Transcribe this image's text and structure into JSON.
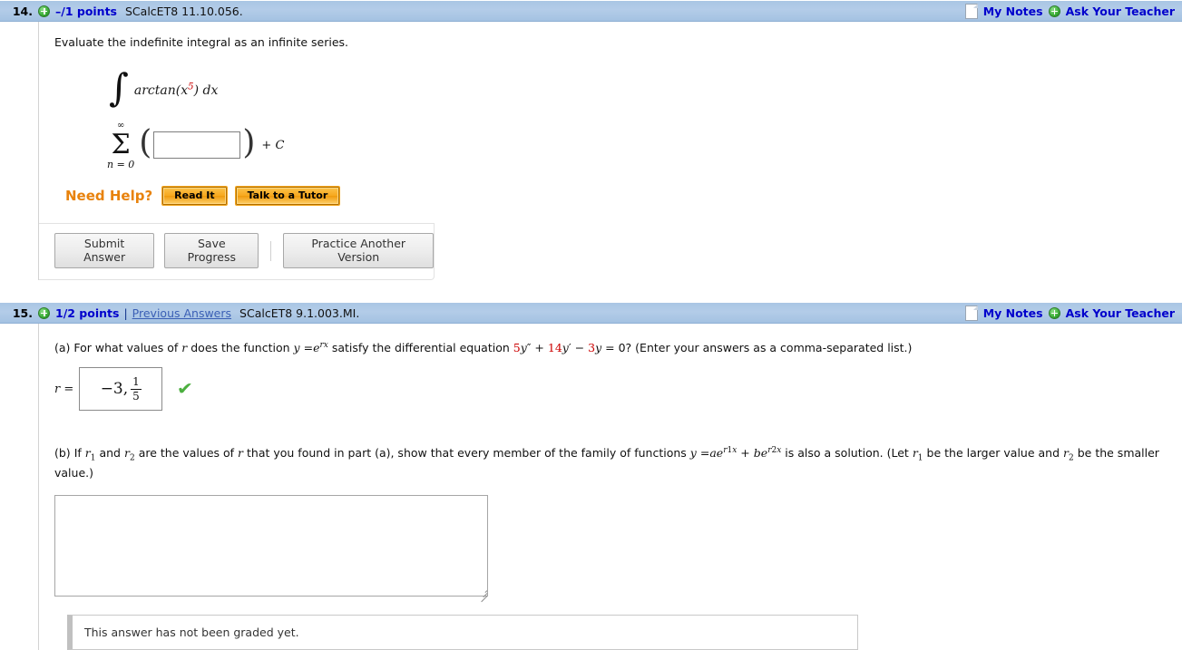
{
  "questions": [
    {
      "number": "14.",
      "points": "–/1 points",
      "code": "SCalcET8 11.10.056.",
      "my_notes": "My Notes",
      "ask_teacher": "Ask Your Teacher",
      "prompt": "Evaluate the indefinite integral as an infinite series.",
      "integral": {
        "sign": "∫",
        "integrand_fn": "arctan(",
        "integrand_var": "x",
        "integrand_exp": "5",
        "integrand_close": ")",
        "differential": "dx"
      },
      "series": {
        "sigma": "Σ",
        "upper_limit": "∞",
        "lower_limit": "n = 0",
        "open_paren": "(",
        "close_paren": ")",
        "input_value": "",
        "trailing": "+ C",
        "trailing_plus": "+",
        "trailing_const": "C"
      },
      "need_help_label": "Need Help?",
      "help_buttons": [
        "Read It",
        "Talk to a Tutor"
      ],
      "action_buttons": [
        "Submit Answer",
        "Save Progress",
        "Practice Another Version"
      ]
    },
    {
      "number": "15.",
      "points": "1/2 points",
      "pipe": "|",
      "previous_answers": "Previous Answers",
      "code": "SCalcET8 9.1.003.MI.",
      "my_notes": "My Notes",
      "ask_teacher": "Ask Your Teacher",
      "part_a": {
        "label": "(a)",
        "text_1": "For what values of",
        "var_r": "r",
        "text_2": "does the function",
        "y": "y",
        "eq": "=",
        "e": "e",
        "e_exp_r": "r",
        "e_exp_x": "x",
        "text_3": "satisfy the differential equation",
        "coef_1": "5",
        "term_1_var": "y",
        "term_1_prime": "″",
        "op_1": "+",
        "coef_2": "14",
        "term_2_var": "y",
        "term_2_prime": "′",
        "op_2": "−",
        "coef_3": "3",
        "term_3_var": "y",
        "text_4": "= 0? (Enter your answers as a comma-separated list.)",
        "answer_label": "r =",
        "answer_whole": "−3,",
        "answer_frac_num": "1",
        "answer_frac_den": "5",
        "check_icon": "✔"
      },
      "part_b": {
        "label": "(b)",
        "text_1": "If",
        "r1": "r",
        "r1_sub": "1",
        "text_2": "and",
        "r2": "r",
        "r2_sub": "2",
        "text_3": "are the values of",
        "var_r": "r",
        "text_4": "that you found in part (a), show that every member of the family of functions",
        "y": "y",
        "eq": "=",
        "a": "a",
        "e1": "e",
        "e1_exp_r": "r",
        "e1_exp_sub": "1",
        "e1_exp_x": "x",
        "plus": "+",
        "b": "b",
        "e2": "e",
        "e2_exp_r": "r",
        "e2_exp_sub": "2",
        "e2_exp_x": "x",
        "text_5": "is also a solution. (Let",
        "let_r1": "r",
        "let_r1_sub": "1",
        "text_6": "be the larger value and",
        "let_r2": "r",
        "let_r2_sub": "2",
        "text_7": "be the smaller value.)",
        "essay_value": "",
        "grade_note": "This answer has not been graded yet."
      }
    }
  ],
  "colors": {
    "header_blue": "#a9c6e4",
    "link_blue": "#0000cc",
    "accent_orange": "#e8820c",
    "coefficient_red": "#cc0000",
    "check_green": "#4caf3f"
  }
}
